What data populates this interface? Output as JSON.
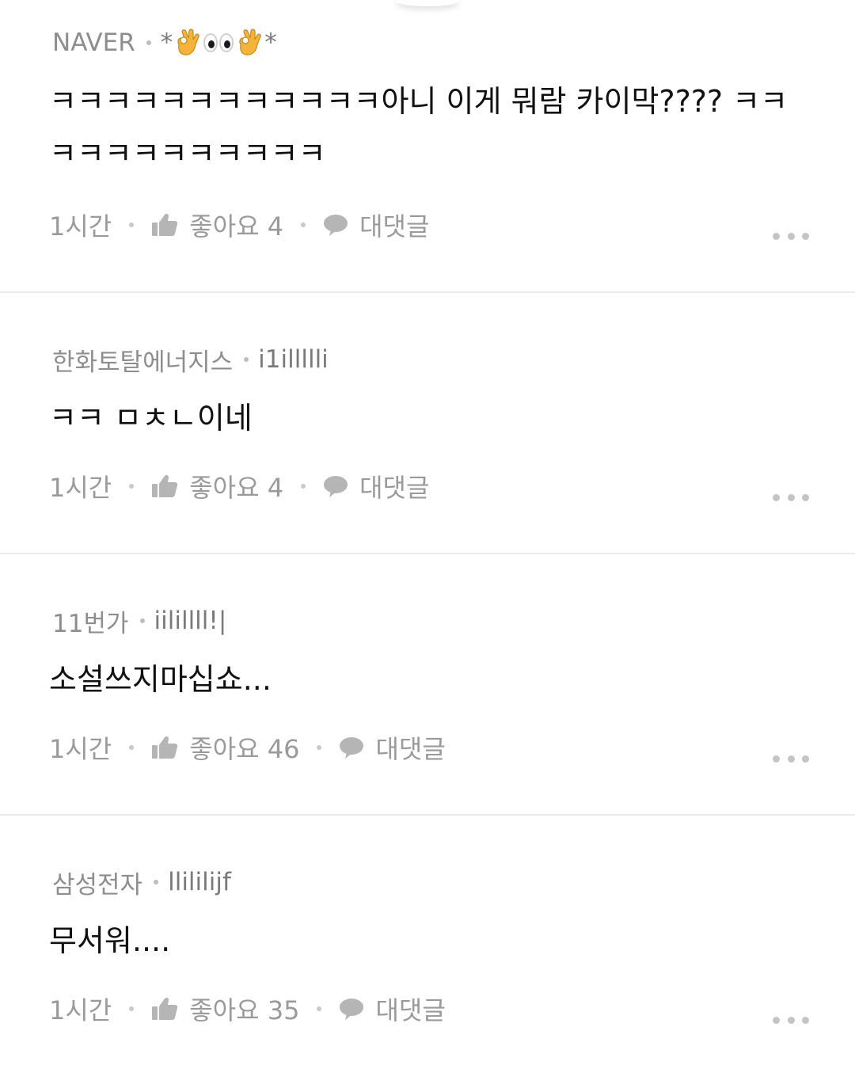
{
  "comments": [
    {
      "source": "NAVER",
      "nickname_prefix": "*",
      "nickname_suffix": "*",
      "nickname_emoji": [
        "ok-hand-icon",
        "eyes-icon",
        "ok-hand-icon"
      ],
      "text": "ㅋㅋㅋㅋㅋㅋㅋㅋㅋㅋㅋㅋ아니 이게 뭐람 카이막???? ㅋㅋㅋㅋㅋㅋㅋㅋㅋㅋㅋㅋ",
      "time": "1시간",
      "like_label": "좋아요 4",
      "reply_label": "대댓글"
    },
    {
      "source": "한화토탈에너지스",
      "nickname": "i1illllli",
      "text": "ㅋㅋ ㅁㅊㄴ이네",
      "time": "1시간",
      "like_label": "좋아요 4",
      "reply_label": "대댓글"
    },
    {
      "source": "11번가",
      "nickname": "iilillll!|",
      "text": "소설쓰지마십쇼...",
      "time": "1시간",
      "like_label": "좋아요 46",
      "reply_label": "대댓글"
    },
    {
      "source": "삼성전자",
      "nickname": "llililijf",
      "text": "무서워....",
      "time": "1시간",
      "like_label": "좋아요 35",
      "reply_label": "대댓글"
    }
  ],
  "colors": {
    "meta": "#8e8e8e",
    "text": "#111111",
    "actions": "#9a9a9a",
    "divider": "#ececec"
  }
}
